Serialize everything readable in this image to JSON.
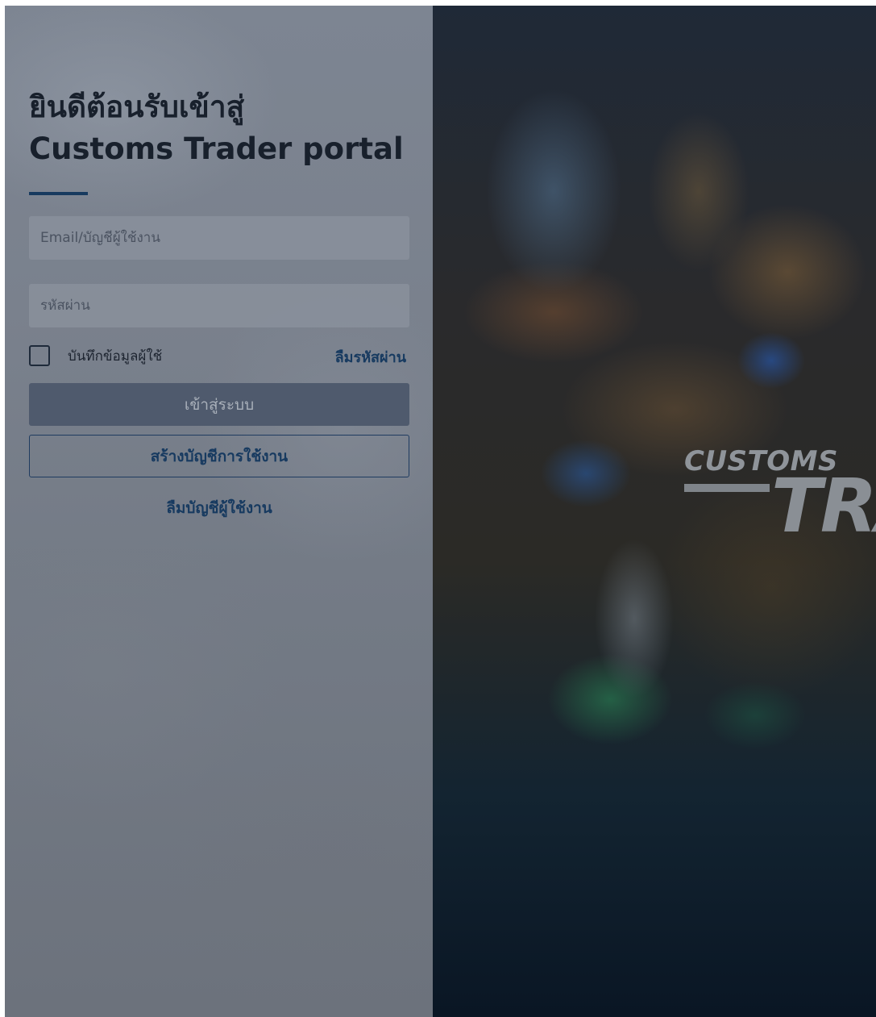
{
  "login": {
    "title_line1": "ยินดีต้อนรับเข้าสู่",
    "title_line2": "Customs Trader portal",
    "email_placeholder": "Email/บัญชีผู้ใช้งาน",
    "password_placeholder": "รหัสผ่าน",
    "remember_label": "บันทึกข้อมูลผู้ใช้",
    "forgot_password": "ลืมรหัสผ่าน",
    "login_button": "เข้าสู่ระบบ",
    "create_account_button": "สร้างบัญชีการใช้งาน",
    "forgot_account": "ลืมบัญชีผู้ใช้งาน"
  },
  "brand": {
    "line1": "CUSTOMS",
    "line2": "TRA"
  },
  "colors": {
    "accent": "#173a60",
    "login_button_bg": "#4f5a6d",
    "input_bg": "#8a919c"
  }
}
